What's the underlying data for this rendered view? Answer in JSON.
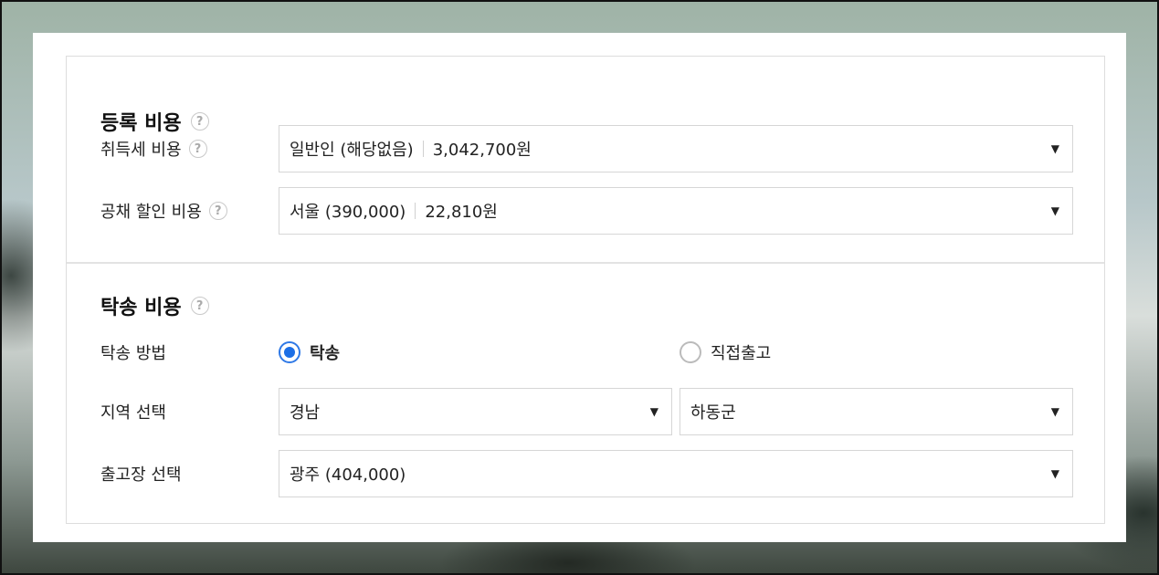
{
  "registration": {
    "title": "등록 비용",
    "acquisition_tax": {
      "label": "취득세 비용",
      "value_main": "일반인 (해당없음)",
      "value_amount": "3,042,700원"
    },
    "bond_discount": {
      "label": "공채 할인 비용",
      "value_main": "서울 (390,000)",
      "value_amount": "22,810원"
    }
  },
  "shipping": {
    "title": "탁송 비용",
    "method": {
      "label": "탁송 방법",
      "options": [
        {
          "label": "탁송",
          "selected": true
        },
        {
          "label": "직접출고",
          "selected": false
        }
      ]
    },
    "region": {
      "label": "지역 선택",
      "province": "경남",
      "district": "하동군"
    },
    "depot": {
      "label": "출고장 선택",
      "value": "광주 (404,000)"
    }
  },
  "icons": {
    "help": "?",
    "caret": "▼",
    "help_icon": "question-circle-icon",
    "caret_icon": "caret-down-icon"
  },
  "colors": {
    "accent": "#1c6fe6"
  }
}
